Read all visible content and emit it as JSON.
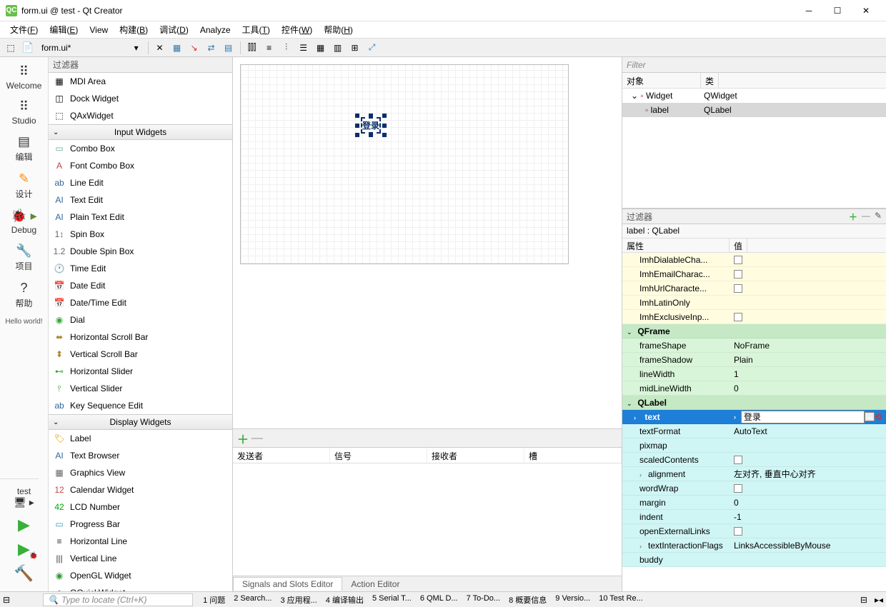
{
  "window": {
    "title": "form.ui @ test - Qt Creator",
    "app_icon_text": "QC"
  },
  "menu": [
    "文件(F)",
    "编辑(E)",
    "View",
    "构建(B)",
    "调试(D)",
    "Analyze",
    "工具(T)",
    "控件(W)",
    "帮助(H)"
  ],
  "toolbar": {
    "doc_name": "form.ui*"
  },
  "leftbar": {
    "items": [
      {
        "label": "Welcome",
        "icon": "⠿"
      },
      {
        "label": "Studio",
        "icon": "⠿"
      },
      {
        "label": "编辑",
        "icon": "▤"
      },
      {
        "label": "设计",
        "icon": "✎",
        "cls": "design"
      },
      {
        "label": "Debug",
        "icon": "🐞",
        "cls": "debug"
      },
      {
        "label": "项目",
        "icon": "🔧"
      },
      {
        "label": "帮助",
        "icon": "?"
      }
    ],
    "hello": "Hello world!",
    "test_label": "test"
  },
  "widget_panel": {
    "filter": "过滤器",
    "items_top": [
      {
        "name": "MDI Area",
        "icon": "▦"
      },
      {
        "name": "Dock Widget",
        "icon": "◫"
      },
      {
        "name": "QAxWidget",
        "icon": "⬚"
      }
    ],
    "section1": "Input Widgets",
    "input_widgets": [
      {
        "name": "Combo Box",
        "icon": "▭",
        "cls": "wi-combo"
      },
      {
        "name": "Font Combo Box",
        "icon": "A",
        "cls": "wi-font"
      },
      {
        "name": "Line Edit",
        "icon": "ab",
        "cls": "wi-edit"
      },
      {
        "name": "Text Edit",
        "icon": "AI",
        "cls": "wi-edit"
      },
      {
        "name": "Plain Text Edit",
        "icon": "AI",
        "cls": "wi-edit"
      },
      {
        "name": "Spin Box",
        "icon": "1↕",
        "cls": "wi-spin"
      },
      {
        "name": "Double Spin Box",
        "icon": "1.2",
        "cls": "wi-spin"
      },
      {
        "name": "Time Edit",
        "icon": "🕐",
        "cls": "wi-time"
      },
      {
        "name": "Date Edit",
        "icon": "📅",
        "cls": "wi-date"
      },
      {
        "name": "Date/Time Edit",
        "icon": "📅",
        "cls": "wi-date"
      },
      {
        "name": "Dial",
        "icon": "◉",
        "cls": "wi-dial"
      },
      {
        "name": "Horizontal Scroll Bar",
        "icon": "⬌",
        "cls": "wi-hbar"
      },
      {
        "name": "Vertical Scroll Bar",
        "icon": "⬍",
        "cls": "wi-vbar"
      },
      {
        "name": "Horizontal Slider",
        "icon": "⊷",
        "cls": "wi-hslide"
      },
      {
        "name": "Vertical Slider",
        "icon": "⫯",
        "cls": "wi-vslide"
      },
      {
        "name": "Key Sequence Edit",
        "icon": "ab",
        "cls": "wi-key"
      }
    ],
    "section2": "Display Widgets",
    "display_widgets": [
      {
        "name": "Label",
        "icon": "🏷",
        "cls": "wi-label"
      },
      {
        "name": "Text Browser",
        "icon": "AI",
        "cls": "wi-tbrowser"
      },
      {
        "name": "Graphics View",
        "icon": "▦",
        "cls": "wi-graph"
      },
      {
        "name": "Calendar Widget",
        "icon": "12",
        "cls": "wi-cal"
      },
      {
        "name": "LCD Number",
        "icon": "42",
        "cls": "wi-lcd"
      },
      {
        "name": "Progress Bar",
        "icon": "▭",
        "cls": "wi-prog"
      },
      {
        "name": "Horizontal Line",
        "icon": "≡",
        "cls": "wi-hline"
      },
      {
        "name": "Vertical Line",
        "icon": "|||",
        "cls": "wi-vline"
      },
      {
        "name": "OpenGL Widget",
        "icon": "◉",
        "cls": "wi-ogl"
      },
      {
        "name": "QQuickWidget",
        "icon": "◈",
        "cls": "wi-qq"
      }
    ]
  },
  "canvas": {
    "label_text": "登录"
  },
  "signals": {
    "headers": [
      "发送者",
      "信号",
      "接收者",
      "槽"
    ],
    "tabs": [
      "Signals and Slots Editor",
      "Action Editor"
    ]
  },
  "object_tree": {
    "filter": "Filter",
    "headers": [
      "对象",
      "类"
    ],
    "rows": [
      {
        "obj": "Widget",
        "cls": "QWidget",
        "indent": 0,
        "exp": true
      },
      {
        "obj": "label",
        "cls": "QLabel",
        "indent": 1,
        "selected": true
      }
    ]
  },
  "property_editor": {
    "filter": "过滤器",
    "title": "label : QLabel",
    "headers": [
      "属性",
      "值"
    ],
    "groups": [
      {
        "type": "yellow",
        "rows": [
          {
            "name": "ImhDialableCha...",
            "value": "checkbox"
          },
          {
            "name": "ImhEmailCharac...",
            "value": "checkbox"
          },
          {
            "name": "ImhUrlCharacte...",
            "value": "checkbox"
          },
          {
            "name": "ImhLatinOnly",
            "value": ""
          },
          {
            "name": "ImhExclusiveInp...",
            "value": "checkbox"
          }
        ]
      },
      {
        "type": "green-h",
        "header": "QFrame"
      },
      {
        "type": "green",
        "rows": [
          {
            "name": "frameShape",
            "value": "NoFrame"
          },
          {
            "name": "frameShadow",
            "value": "Plain"
          },
          {
            "name": "lineWidth",
            "value": "1"
          },
          {
            "name": "midLineWidth",
            "value": "0"
          }
        ]
      },
      {
        "type": "green-h",
        "header": "QLabel"
      },
      {
        "type": "blue-h",
        "rows": [
          {
            "name": "text",
            "value": "登录",
            "editing": true
          }
        ]
      },
      {
        "type": "cyan",
        "rows": [
          {
            "name": "textFormat",
            "value": "AutoText"
          },
          {
            "name": "pixmap",
            "value": ""
          },
          {
            "name": "scaledContents",
            "value": "checkbox"
          },
          {
            "name": "alignment",
            "value": "左对齐, 垂直中心对齐",
            "chev": true
          },
          {
            "name": "wordWrap",
            "value": "checkbox"
          },
          {
            "name": "margin",
            "value": "0"
          },
          {
            "name": "indent",
            "value": "-1"
          },
          {
            "name": "openExternalLinks",
            "value": "checkbox"
          },
          {
            "name": "textInteractionFlags",
            "value": "LinksAccessibleByMouse",
            "chev": true
          },
          {
            "name": "buddy",
            "value": ""
          }
        ]
      }
    ]
  },
  "statusbar": {
    "locator_placeholder": "Type to locate (Ctrl+K)",
    "items": [
      "1  问题",
      "2  Search...",
      "3  应用程...",
      "4  编译输出",
      "5  Serial T...",
      "6  QML D...",
      "7  To-Do...",
      "8  概要信息",
      "9  Versio...",
      "10  Test Re..."
    ]
  }
}
